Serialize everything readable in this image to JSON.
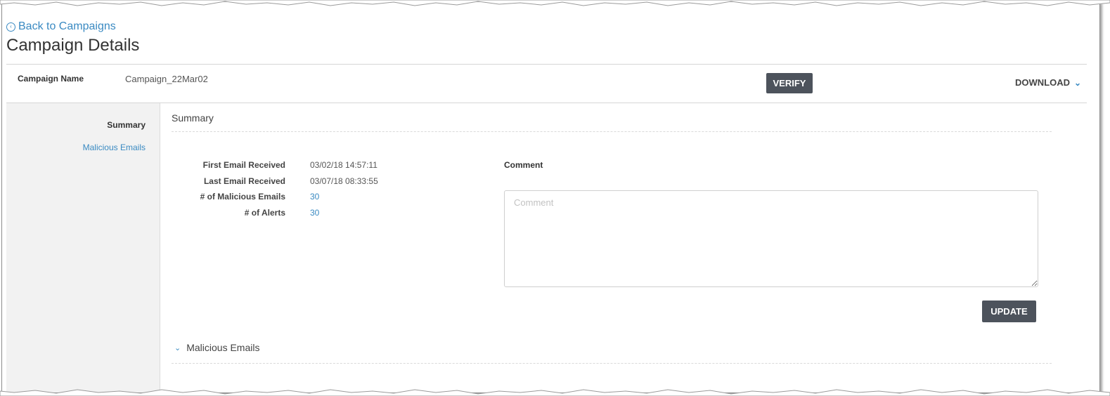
{
  "nav": {
    "back_label": "Back to Campaigns"
  },
  "page": {
    "title": "Campaign Details"
  },
  "campaign": {
    "name_label": "Campaign Name",
    "name_value": "Campaign_22Mar02"
  },
  "toolbar": {
    "verify_label": "VERIFY",
    "download_label": "DOWNLOAD"
  },
  "sidebar": {
    "items": [
      {
        "label": "Summary",
        "active": true
      },
      {
        "label": "Malicious Emails",
        "active": false
      }
    ]
  },
  "summary": {
    "title": "Summary",
    "stats": [
      {
        "label": "First Email Received",
        "value": "03/02/18 14:57:11"
      },
      {
        "label": "Last Email Received",
        "value": "03/07/18 08:33:55"
      },
      {
        "label": "# of Malicious Emails",
        "value": "30"
      },
      {
        "label": "# of Alerts",
        "value": "30"
      }
    ],
    "comment_label": "Comment",
    "comment_placeholder": "Comment",
    "comment_value": "",
    "update_label": "UPDATE"
  },
  "malicious_section": {
    "title": "Malicious Emails"
  },
  "colors": {
    "link": "#3a8ac2",
    "button": "#4d535c",
    "sidebar_bg": "#f2f2f2"
  },
  "icons": {
    "back": "circle-arrow-left-icon",
    "download": "chevron-down-icon",
    "section": "chevron-down-icon"
  }
}
